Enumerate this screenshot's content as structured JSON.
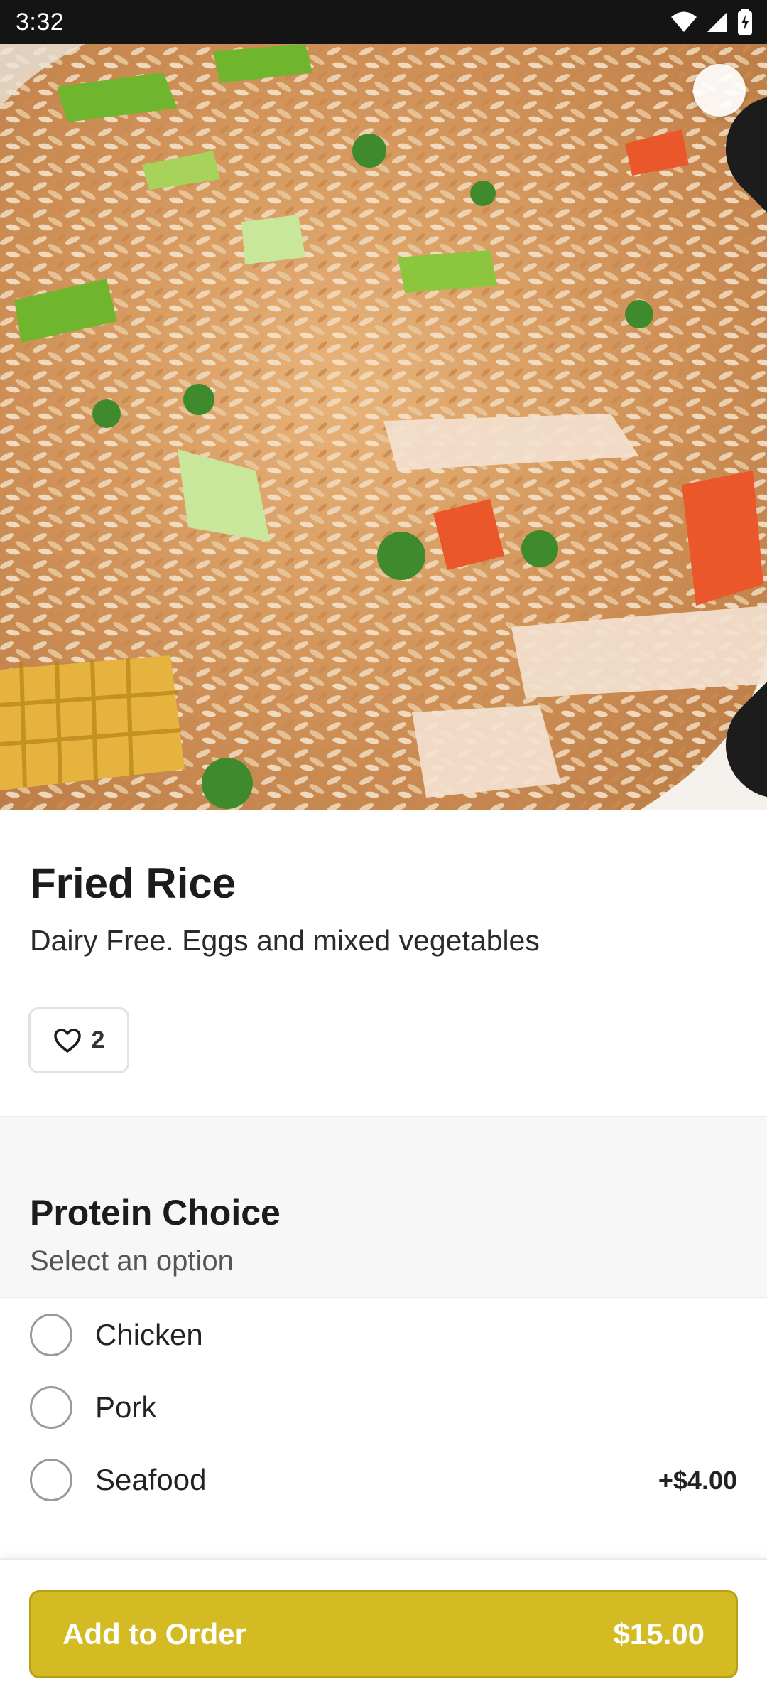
{
  "status_bar": {
    "time": "3:32",
    "icons": [
      "wifi-icon",
      "signal-icon",
      "battery-charging-icon"
    ]
  },
  "hero": {
    "close_icon": "close-icon"
  },
  "item": {
    "title": "Fried Rice",
    "description": "Dairy Free. Eggs and mixed vegetables",
    "favorite_count": "2",
    "favorite_icon": "heart-icon"
  },
  "section": {
    "title": "Protein Choice",
    "subtitle": "Select an option"
  },
  "options": [
    {
      "label": "Chicken",
      "price": ""
    },
    {
      "label": "Pork",
      "price": ""
    },
    {
      "label": "Seafood",
      "price": "+$4.00"
    }
  ],
  "order_button": {
    "label": "Add to Order",
    "price": "$15.00"
  },
  "colors": {
    "accent": "#d5bb23",
    "status_bar": "#141414",
    "section_bg": "#f7f7f7"
  }
}
